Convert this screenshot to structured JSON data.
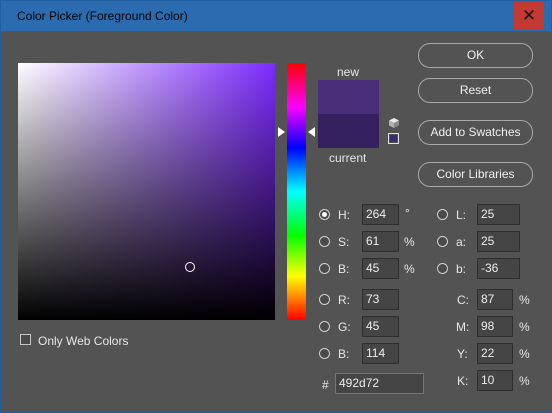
{
  "window": {
    "title": "Color Picker (Foreground Color)",
    "close_glyph": "✕"
  },
  "buttons": {
    "ok": "OK",
    "reset": "Reset",
    "add_to_swatches": "Add to Swatches",
    "color_libraries": "Color Libraries"
  },
  "preview": {
    "new_label": "new",
    "current_label": "current",
    "new_color": "#4a2e7a",
    "current_color": "#352060"
  },
  "picker": {
    "selected_color": "#492d72",
    "hue_degrees": 264
  },
  "hsb": {
    "h": {
      "label": "H:",
      "value": "264",
      "unit": "°",
      "selected": true
    },
    "s": {
      "label": "S:",
      "value": "61",
      "unit": "%",
      "selected": false
    },
    "b": {
      "label": "B:",
      "value": "45",
      "unit": "%",
      "selected": false
    }
  },
  "lab": {
    "l": {
      "label": "L:",
      "value": "25",
      "selected": false
    },
    "a": {
      "label": "a:",
      "value": "25",
      "selected": false
    },
    "b": {
      "label": "b:",
      "value": "-36",
      "selected": false
    }
  },
  "rgb": {
    "r": {
      "label": "R:",
      "value": "73",
      "selected": false
    },
    "g": {
      "label": "G:",
      "value": "45",
      "selected": false
    },
    "b": {
      "label": "B:",
      "value": "114",
      "selected": false
    }
  },
  "cmyk": {
    "c": {
      "label": "C:",
      "value": "87",
      "unit": "%"
    },
    "m": {
      "label": "M:",
      "value": "98",
      "unit": "%"
    },
    "y": {
      "label": "Y:",
      "value": "22",
      "unit": "%"
    },
    "k": {
      "label": "K:",
      "value": "10",
      "unit": "%"
    }
  },
  "hex": {
    "label": "#",
    "value": "492d72"
  },
  "only_web_colors": {
    "label": "Only Web Colors",
    "checked": false
  }
}
